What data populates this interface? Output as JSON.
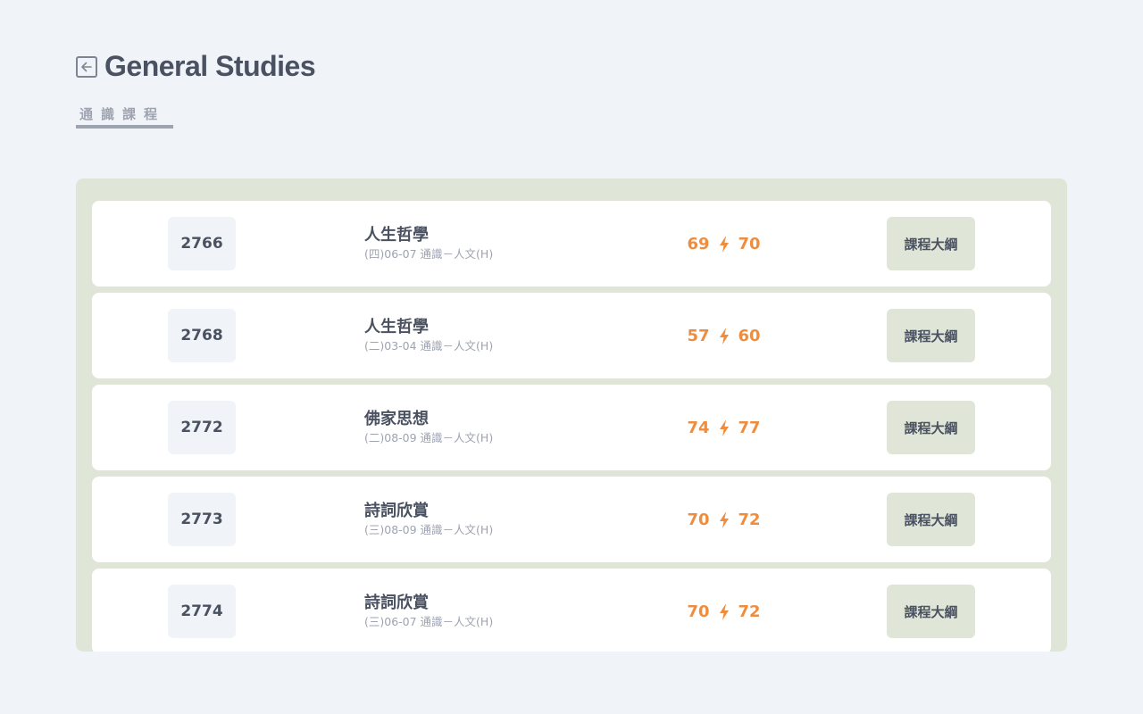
{
  "header": {
    "title": "General Studies",
    "back_icon": "arrow-left-icon"
  },
  "tabs": [
    {
      "label": "通識課程",
      "active": true
    }
  ],
  "courses": [
    {
      "code": "2766",
      "name": "人生哲學",
      "meta": "(四)06-07 通識－人文(H)",
      "enrolled": "69",
      "capacity": "70",
      "syllabus_label": "課程大綱"
    },
    {
      "code": "2768",
      "name": "人生哲學",
      "meta": "(二)03-04 通識－人文(H)",
      "enrolled": "57",
      "capacity": "60",
      "syllabus_label": "課程大綱"
    },
    {
      "code": "2772",
      "name": "佛家思想",
      "meta": "(二)08-09 通識－人文(H)",
      "enrolled": "74",
      "capacity": "77",
      "syllabus_label": "課程大綱"
    },
    {
      "code": "2773",
      "name": "詩詞欣賞",
      "meta": "(三)08-09 通識－人文(H)",
      "enrolled": "70",
      "capacity": "72",
      "syllabus_label": "課程大綱"
    },
    {
      "code": "2774",
      "name": "詩詞欣賞",
      "meta": "(三)06-07 通識－人文(H)",
      "enrolled": "70",
      "capacity": "72",
      "syllabus_label": "課程大綱"
    }
  ],
  "colors": {
    "accent": "#ef8d3f",
    "panel": "#e0e6d7",
    "text": "#4a5160",
    "muted": "#9ea3b0"
  },
  "icons": {
    "stat_separator": "lightning-bolt-icon"
  }
}
